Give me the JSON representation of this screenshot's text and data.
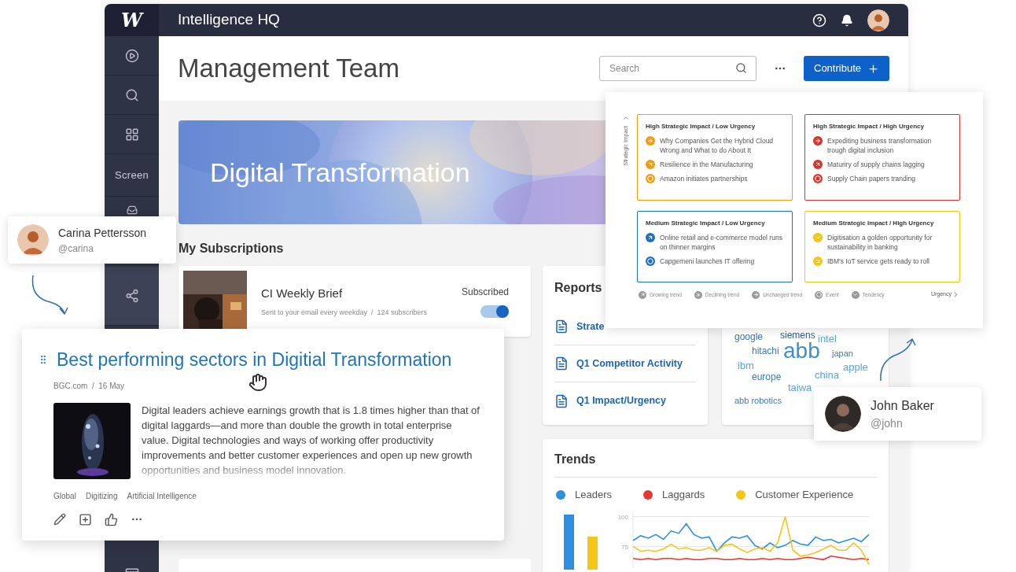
{
  "app": {
    "logo": "W",
    "title": "Intelligence HQ"
  },
  "sidebar": {
    "items": [
      {
        "kind": "icon",
        "selected": false
      },
      {
        "kind": "icon",
        "selected": false
      },
      {
        "kind": "icon",
        "selected": false
      },
      {
        "kind": "label",
        "label": "Screen",
        "selected": false
      },
      {
        "kind": "icon",
        "selected": false
      },
      {
        "kind": "icon",
        "selected": true
      },
      {
        "kind": "icon",
        "selected": false
      }
    ]
  },
  "page": {
    "title": "Management Team",
    "search": {
      "placeholder": "Search"
    },
    "contribute": "Contribute"
  },
  "banner": {
    "title": "Digital Transformation"
  },
  "subscriptions": {
    "heading": "My Subscriptions",
    "items": [
      {
        "title": "CI Weekly Brief",
        "meta": "Sent to your email every weekday  /  124 subscribers",
        "status": "Subscribed",
        "on": true
      }
    ]
  },
  "reports": {
    "heading": "Reports",
    "items": [
      "Strate",
      "Q1 Competitor Activity",
      "Q1 Impact/Urgency"
    ]
  },
  "word_cloud": {
    "words": [
      "google",
      "siemens",
      "intel",
      "hitachi",
      "abb",
      "japan",
      "ibm",
      "apple",
      "europe",
      "china",
      "taiwa",
      "abb robotics"
    ]
  },
  "trends": {
    "heading": "Trends",
    "chart_data": {
      "type": "line",
      "yticks": [
        75,
        100
      ],
      "ylim": [
        57,
        103
      ],
      "series": [
        {
          "name": "Leaders",
          "color": "#2e8fe0",
          "values": [
            80,
            84,
            82,
            85,
            81,
            88,
            86,
            94,
            85,
            82,
            83,
            71,
            78,
            83,
            82,
            84,
            76,
            73,
            78,
            74,
            76,
            80,
            77,
            76,
            83,
            80,
            81,
            78,
            80,
            82,
            79,
            85
          ]
        },
        {
          "name": "Laggards",
          "color": "#e53935",
          "values": [
            65,
            64,
            65,
            64,
            65,
            65,
            64,
            65,
            64,
            64,
            65,
            65,
            64,
            64,
            65,
            64,
            64,
            65,
            64,
            65,
            64,
            64,
            65,
            66,
            65,
            64,
            67,
            66,
            65,
            64,
            65,
            64
          ]
        },
        {
          "name": "Customer Experience",
          "color": "#f5c518",
          "values": [
            75,
            71,
            72,
            71,
            73,
            77,
            73,
            74,
            72,
            72,
            74,
            71,
            76,
            77,
            73,
            70,
            73,
            74,
            71,
            78,
            100,
            72,
            67,
            68,
            70,
            73,
            76,
            72,
            72,
            78,
            72,
            60
          ]
        }
      ]
    }
  },
  "matrix": {
    "y_axis": "Strategic Impact",
    "x_axis": "Urgency",
    "quadrants": [
      {
        "title": "High Strategic Impact / Low Urgency",
        "color": "#f39c12",
        "items": [
          {
            "text": "Why Companies Get the Hybrid Cloud Wrong and What to do About It",
            "kind": "unchanged"
          },
          {
            "text": "Resilience in the Manufacturing",
            "kind": "growing"
          },
          {
            "text": "Amazon initiates partnerships",
            "kind": "event"
          }
        ]
      },
      {
        "title": "High Strategic Impact / High Urgency",
        "color": "#d9342b",
        "items": [
          {
            "text": "Expediting business transformation trough digital inclusion",
            "kind": "unchanged"
          },
          {
            "text": "Maturiry of supply chains lagging",
            "kind": "growing"
          },
          {
            "text": "Supply Chain papers tranding",
            "kind": "event"
          }
        ]
      },
      {
        "title": "Medium Strategic Impact / Low Urgency",
        "color": "#1f6fbf",
        "items": [
          {
            "text": "Online retail and e-commerce model runs on thinner margins",
            "kind": "growing"
          },
          {
            "text": "Capgemeni launches IT offering",
            "kind": "event"
          }
        ]
      },
      {
        "title": "Medium Strategic Impact / High Urgency",
        "color": "#f5c518",
        "items": [
          {
            "text": "Digitisation a golden opportunity for sustainability in banking",
            "kind": "tendency"
          },
          {
            "text": "IBM's IoT service gets ready to roll",
            "kind": "declining"
          }
        ]
      }
    ],
    "legend": [
      {
        "label": "Growing trend",
        "kind": "growing"
      },
      {
        "label": "Declining trend",
        "kind": "declining"
      },
      {
        "label": "Unchanged trend",
        "kind": "unchanged"
      },
      {
        "label": "Event",
        "kind": "event"
      },
      {
        "label": "Tendency",
        "kind": "tendency"
      }
    ]
  },
  "people": [
    {
      "name": "Carina Pettersson",
      "handle": "@carina"
    },
    {
      "name": "John Baker",
      "handle": "@john"
    }
  ],
  "article": {
    "title": "Best performing sectors in Digitial Transformation",
    "source": "BGC.com  /  16 May",
    "body": "Digital leaders achieve earnings growth that is 1.8 times higher than that of digital laggards—and more than double the growth in total enterprise value. Digital technologies and ways of working offer productivity improvements and better customer experiences and open up new growth opportunities and business model innovation.",
    "tags": [
      "Global",
      "Digitizing",
      "Artificial Intelligence"
    ]
  }
}
